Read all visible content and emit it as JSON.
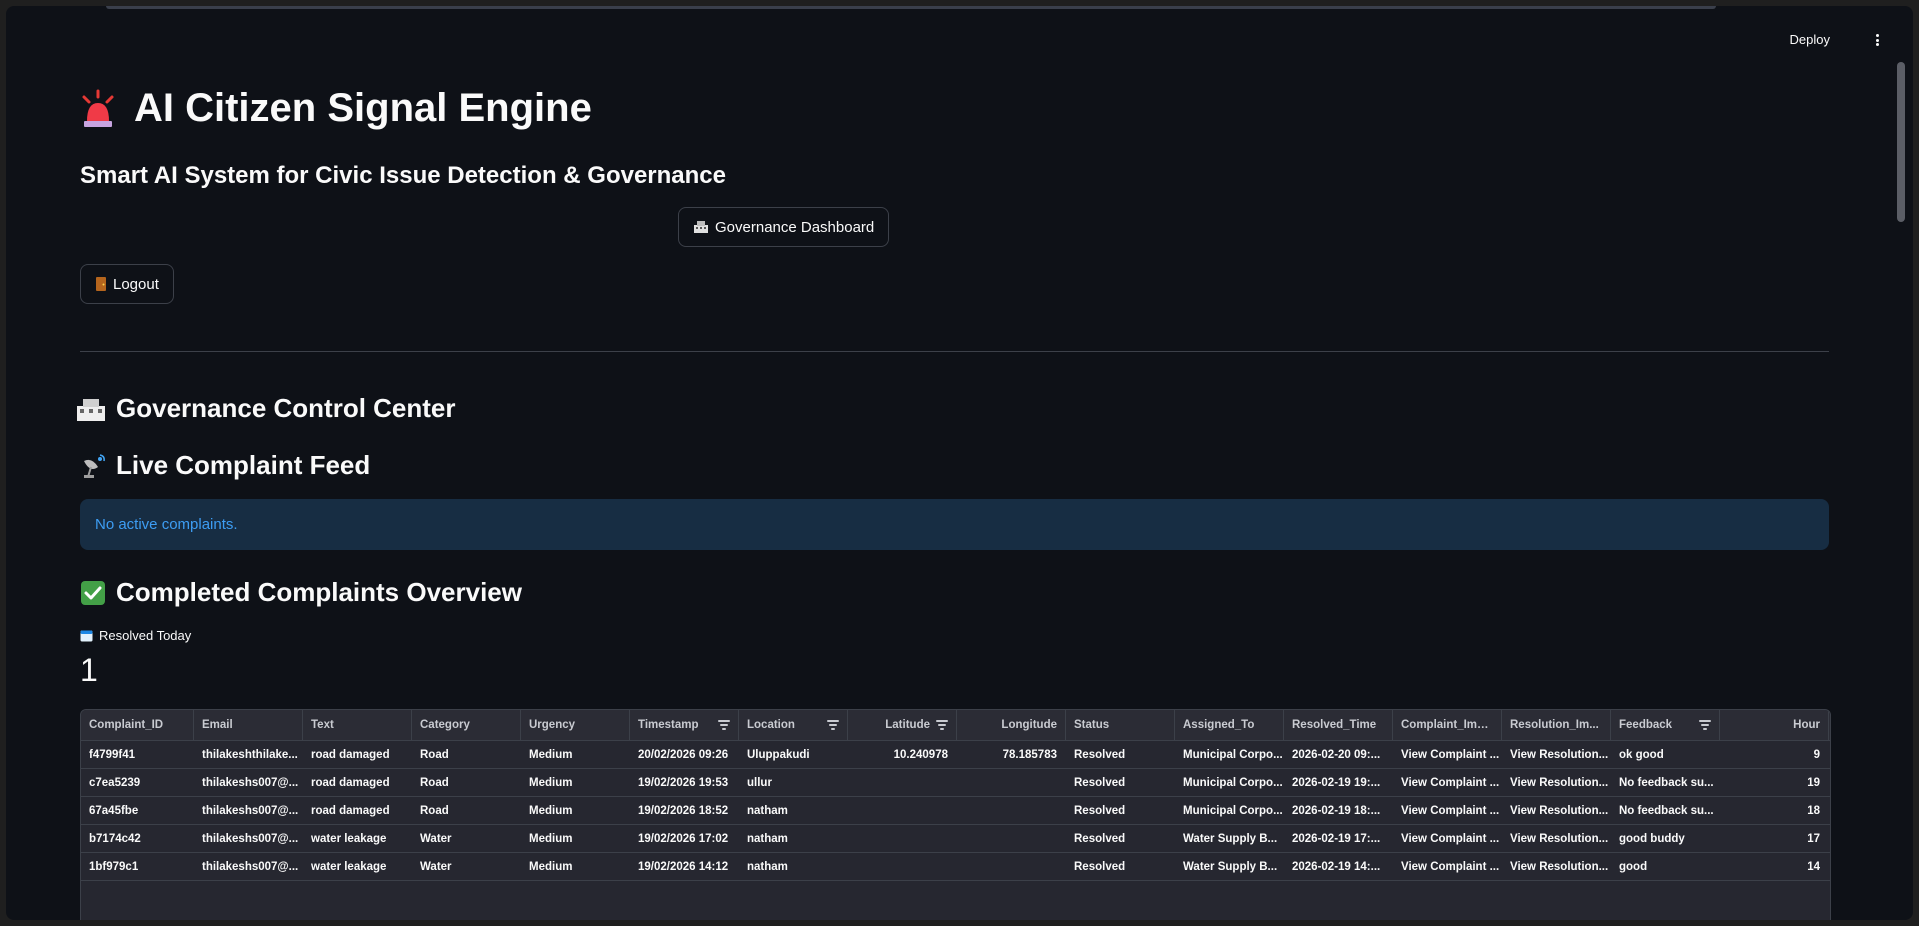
{
  "header": {
    "deploy_label": "Deploy"
  },
  "hero": {
    "title": "AI Citizen Signal Engine",
    "subtitle": "Smart AI System for Civic Issue Detection & Governance"
  },
  "buttons": {
    "dashboard_label": "Governance Dashboard",
    "logout_label": "Logout"
  },
  "sections": {
    "control_center": "Governance Control Center",
    "live_feed": "Live Complaint Feed",
    "completed": "Completed Complaints Overview"
  },
  "alert": {
    "message": "No active complaints."
  },
  "metric": {
    "label": "Resolved Today",
    "value": "1"
  },
  "table": {
    "columns": [
      "Complaint_ID",
      "Email",
      "Text",
      "Category",
      "Urgency",
      "Timestamp",
      "Location",
      "Latitude",
      "Longitude",
      "Status",
      "Assigned_To",
      "Resolved_Time",
      "Complaint_Ima...",
      "Resolution_Im...",
      "Feedback",
      "Hour"
    ],
    "rows": [
      [
        "f4799f41",
        "thilakeshthilake...",
        "road damaged",
        "Road",
        "Medium",
        "20/02/2026 09:26",
        "Uluppakudi",
        "10.240978",
        "78.185783",
        "Resolved",
        "Municipal Corpo...",
        "2026-02-20 09:...",
        "View Complaint ...",
        "View Resolution...",
        "ok good",
        "9"
      ],
      [
        "c7ea5239",
        "thilakeshs007@...",
        "road damaged",
        "Road",
        "Medium",
        "19/02/2026 19:53",
        "ullur",
        "",
        "",
        "Resolved",
        "Municipal Corpo...",
        "2026-02-19 19:...",
        "View Complaint ...",
        "View Resolution...",
        "No feedback su...",
        "19"
      ],
      [
        "67a45fbe",
        "thilakeshs007@...",
        "road damaged",
        "Road",
        "Medium",
        "19/02/2026 18:52",
        "natham",
        "",
        "",
        "Resolved",
        "Municipal Corpo...",
        "2026-02-19 18:...",
        "View Complaint ...",
        "View Resolution...",
        "No feedback su...",
        "18"
      ],
      [
        "b7174c42",
        "thilakeshs007@...",
        "water leakage",
        "Water",
        "Medium",
        "19/02/2026 17:02",
        "natham",
        "",
        "",
        "Resolved",
        "Water Supply B...",
        "2026-02-19 17:...",
        "View Complaint ...",
        "View Resolution...",
        "good buddy",
        "17"
      ],
      [
        "1bf979c1",
        "thilakeshs007@...",
        "water leakage",
        "Water",
        "Medium",
        "19/02/2026 14:12",
        "natham",
        "",
        "",
        "Resolved",
        "Water Supply B...",
        "2026-02-19 14:...",
        "View Complaint ...",
        "View Resolution...",
        "good",
        "14"
      ]
    ]
  }
}
